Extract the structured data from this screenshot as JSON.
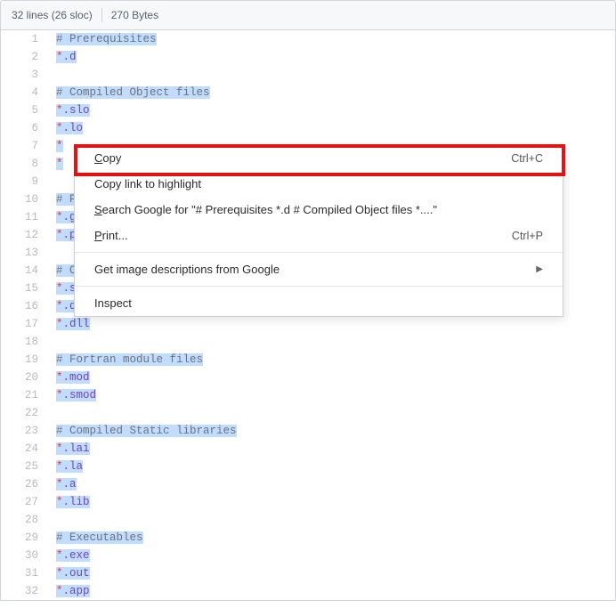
{
  "header": {
    "lines": "32 lines (26 sloc)",
    "bytes": "270 Bytes"
  },
  "code": {
    "lines": [
      {
        "n": "1",
        "type": "comment",
        "text": "# Prerequisites",
        "sel": true
      },
      {
        "n": "2",
        "type": "glob",
        "star": "*",
        "ext": ".d",
        "sel": true
      },
      {
        "n": "3",
        "type": "blank",
        "text": "",
        "sel": false
      },
      {
        "n": "4",
        "type": "comment",
        "text": "# Compiled Object files",
        "sel": true
      },
      {
        "n": "5",
        "type": "glob",
        "star": "*",
        "ext": ".slo",
        "sel": true
      },
      {
        "n": "6",
        "type": "glob",
        "star": "*",
        "ext": ".lo",
        "sel": true
      },
      {
        "n": "7",
        "type": "globcut",
        "star": "*",
        "ext": "",
        "sel": true
      },
      {
        "n": "8",
        "type": "globcut",
        "star": "*",
        "ext": "",
        "sel": true
      },
      {
        "n": "9",
        "type": "blank",
        "text": "",
        "sel": false
      },
      {
        "n": "10",
        "type": "commentcut",
        "text": "# P",
        "sel": true
      },
      {
        "n": "11",
        "type": "globcut",
        "star": "*",
        "ext": ".g",
        "sel": true
      },
      {
        "n": "12",
        "type": "globcut",
        "star": "*",
        "ext": ".p",
        "sel": true
      },
      {
        "n": "13",
        "type": "blank",
        "text": "",
        "sel": false
      },
      {
        "n": "14",
        "type": "commentcut",
        "text": "# C",
        "sel": true
      },
      {
        "n": "15",
        "type": "globcut",
        "star": "*",
        "ext": ".s",
        "sel": true
      },
      {
        "n": "16",
        "type": "globcut",
        "star": "*",
        "ext": ".d",
        "sel": true
      },
      {
        "n": "17",
        "type": "glob",
        "star": "*",
        "ext": ".dll",
        "sel": true
      },
      {
        "n": "18",
        "type": "blank",
        "text": "",
        "sel": false
      },
      {
        "n": "19",
        "type": "comment",
        "text": "# Fortran module files",
        "sel": true
      },
      {
        "n": "20",
        "type": "glob",
        "star": "*",
        "ext": ".mod",
        "sel": true
      },
      {
        "n": "21",
        "type": "glob",
        "star": "*",
        "ext": ".smod",
        "sel": true
      },
      {
        "n": "22",
        "type": "blank",
        "text": "",
        "sel": false
      },
      {
        "n": "23",
        "type": "comment",
        "text": "# Compiled Static libraries",
        "sel": true
      },
      {
        "n": "24",
        "type": "glob",
        "star": "*",
        "ext": ".lai",
        "sel": true
      },
      {
        "n": "25",
        "type": "glob",
        "star": "*",
        "ext": ".la",
        "sel": true
      },
      {
        "n": "26",
        "type": "glob",
        "star": "*",
        "ext": ".a",
        "sel": true
      },
      {
        "n": "27",
        "type": "glob",
        "star": "*",
        "ext": ".lib",
        "sel": true
      },
      {
        "n": "28",
        "type": "blank",
        "text": "",
        "sel": false
      },
      {
        "n": "29",
        "type": "comment",
        "text": "# Executables",
        "sel": true
      },
      {
        "n": "30",
        "type": "glob",
        "star": "*",
        "ext": ".exe",
        "sel": true
      },
      {
        "n": "31",
        "type": "glob",
        "star": "*",
        "ext": ".out",
        "sel": true
      },
      {
        "n": "32",
        "type": "glob",
        "star": "*",
        "ext": ".app",
        "sel": true
      }
    ]
  },
  "menu": {
    "copy": {
      "label": "Copy",
      "first": "C",
      "rest": "opy",
      "shortcut": "Ctrl+C"
    },
    "copylink": {
      "label": "Copy link to highlight",
      "first": "",
      "rest": "Copy link to highlight"
    },
    "search": {
      "label": "Search Google for \"# Prerequisites *.d  # Compiled Object files *....\"",
      "first": "S",
      "rest": "earch Google for \"# Prerequisites *.d  # Compiled Object files *....\""
    },
    "print": {
      "label": "Print...",
      "first": "P",
      "rest": "rint...",
      "shortcut": "Ctrl+P"
    },
    "imgdesc": {
      "label": "Get image descriptions from Google"
    },
    "inspect": {
      "label": "Inspect"
    }
  }
}
